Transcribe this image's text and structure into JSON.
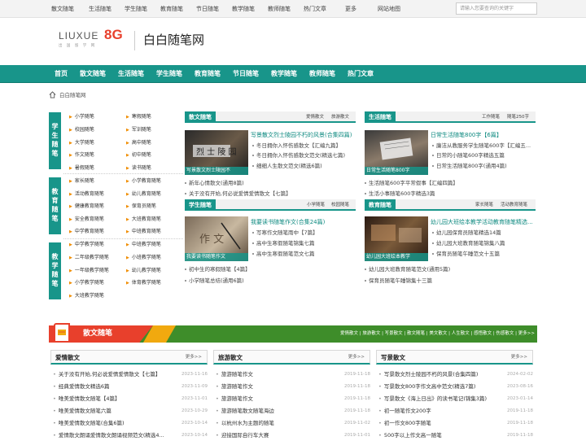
{
  "topbar": {
    "links": [
      "散文随笔",
      "生活随笔",
      "学生随笔",
      "教育随笔",
      "节日随笔",
      "教学随笔",
      "教师随笔",
      "热门文章",
      "更多",
      "网站地图"
    ],
    "search_placeholder": "请输入您要查询的关键字"
  },
  "header": {
    "logo_text": "LIUXUE",
    "logo_mark": "8G",
    "logo_sub": "出 国 留 学 网",
    "site_name": "白白随笔网"
  },
  "nav": {
    "items": [
      "首页",
      "散文随笔",
      "生活随笔",
      "学生随笔",
      "教育随笔",
      "节日随笔",
      "教学随笔",
      "教师随笔",
      "热门文章"
    ]
  },
  "breadcrumb": {
    "home_icon": "home-icon",
    "text": "白白随笔网"
  },
  "categories": [
    {
      "label": "学生随笔",
      "links_left": [
        "小学随笔",
        "校园随笔",
        "大学随笔",
        "作文随笔",
        "暑假随笔"
      ],
      "links_right": [
        "寒假随笔",
        "军训随笔",
        "高中随笔",
        "初中随笔",
        "读书随笔"
      ]
    },
    {
      "label": "教育随笔",
      "links_left": [
        "家长随笔",
        "活动教育随笔",
        "健康教育随笔",
        "安全教育随笔",
        "中学教育随笔"
      ],
      "links_right": [
        "小学教育随笔",
        "幼儿教育随笔",
        "保育员随笔",
        "大班教育随笔",
        "中班教育随笔"
      ]
    },
    {
      "label": "教学随笔",
      "links_left": [
        "中学教学随笔",
        "二年级教学随笔",
        "一年级教学随笔",
        "小学教学随笔",
        "大班教学随笔"
      ],
      "links_right": [
        "中班教学随笔",
        "小班教学随笔",
        "幼儿教学随笔",
        "体育教学随笔"
      ]
    }
  ],
  "boxes": [
    {
      "title": "散文随笔",
      "tags": [
        "爱情散文",
        "旅游散文"
      ],
      "thumb_caption": "写景散文烈士陵园不",
      "headline": "写景散文烈士陵园不朽的风景(合集四篇)",
      "bullets": [
        "冬日拥你入怀伤感散文【汇编九篇】",
        "冬日拥你入怀伤感散文范文(精选七篇)",
        "细细人生散文范文(精选6篇)"
      ],
      "list": [
        "新年心情散文(通用8篇)",
        "关于没有开始,何必说爱情爱情散文【七篇】"
      ]
    },
    {
      "title": "生活随笔",
      "tags": [
        "工作随笔",
        "随笔250字"
      ],
      "thumb_caption": "日常生活随笔800字",
      "headline": "日常生活随笔800字【6篇】",
      "bullets": [
        "廉洁从教服务学生随笔600字【汇编五...",
        "日常的小随笔600字精选五篇",
        "日常生活随笔800字(通用4篇)"
      ],
      "list": [
        "生活随笔600字平常假事【汇编四篇】",
        "生活小事随笔600字精选3篇"
      ]
    },
    {
      "title": "学生随笔",
      "tags": [
        "小学随笔",
        "校园随笔"
      ],
      "thumb_caption": "我要读书随笔作文",
      "headline": "我要读书随笔作文(合集24篇)",
      "bullets": [
        "写寒作文随笔雨中【7篇】",
        "高中生寒假随笔锦集七篇",
        "高中生寒假随笔范文七篇"
      ],
      "list": [
        "初中生的寒假随笔【4篇】",
        "小学随笔总结(通用6篇)"
      ]
    },
    {
      "title": "教育随笔",
      "tags": [
        "家长随笔",
        "活动教育随笔"
      ],
      "thumb_caption": "幼儿园大班绘本教学",
      "headline": "幼儿园大班绘本教学活动教育随笔精选...",
      "bullets": [
        "幼儿园保育员随笔精选14篇",
        "幼儿园大班教育随笔锦集八篇",
        "保育员随笔午睡范文十五篇"
      ],
      "list": [
        "幼儿园大班教育随笔范文(通用5篇)",
        "保育员随笔午睡锦集十三篇"
      ]
    }
  ],
  "band": {
    "title": "散文随笔",
    "links": "爱情散文 | 旅游散文 | 写景散文 | 散文随笔 | 美文散文 | 人生散文 | 感悟散文 | 伤感散文 | 更多>>"
  },
  "columns": [
    {
      "title": "爱情散文",
      "more": "更多>>",
      "rows": [
        {
          "t": "关于没有开始,何必说爱情爱情散文【七篇】",
          "d": "2023-11-16"
        },
        {
          "t": "经典爱情散文精选6篇",
          "d": "2023-11-09"
        },
        {
          "t": "唯美爱情散文随笔【4篇】",
          "d": "2023-11-01"
        },
        {
          "t": "唯美爱情散文随笔六篇",
          "d": "2023-10-29"
        },
        {
          "t": "唯美爱情散文随笔(合集6篇)",
          "d": "2023-10-14"
        },
        {
          "t": "爱情散文朗诵爱情散文朗诵视频范文(精选4...",
          "d": "2023-10-14"
        }
      ]
    },
    {
      "title": "旅游散文",
      "more": "更多>>",
      "rows": [
        {
          "t": "旅游随笔作文",
          "d": "2019-11-18"
        },
        {
          "t": "旅游随笔作文",
          "d": "2019-11-18"
        },
        {
          "t": "旅游随笔作文",
          "d": "2019-11-18"
        },
        {
          "t": "旅游随笔散文随笔海边",
          "d": "2019-11-18"
        },
        {
          "t": "以杭州水为主题的随笔",
          "d": "2019-11-02"
        },
        {
          "t": "迎接国际自行车大赛",
          "d": "2019-11-01"
        }
      ]
    },
    {
      "title": "写景散文",
      "more": "更多>>",
      "rows": [
        {
          "t": "写景散文烈士陵园不朽的风景(合集四篇)",
          "d": "2024-02-02"
        },
        {
          "t": "写景散文800字作文高中范文(精选7篇)",
          "d": "2023-08-16"
        },
        {
          "t": "写景散文《海上日出》的读书笔记(锦集3篇)",
          "d": "2023-01-14"
        },
        {
          "t": "初一随笔作文200字",
          "d": "2019-11-18"
        },
        {
          "t": "初一作文800字随笔",
          "d": "2019-11-18"
        },
        {
          "t": "500字以上作文高一随笔",
          "d": "2019-11-18"
        }
      ]
    }
  ]
}
